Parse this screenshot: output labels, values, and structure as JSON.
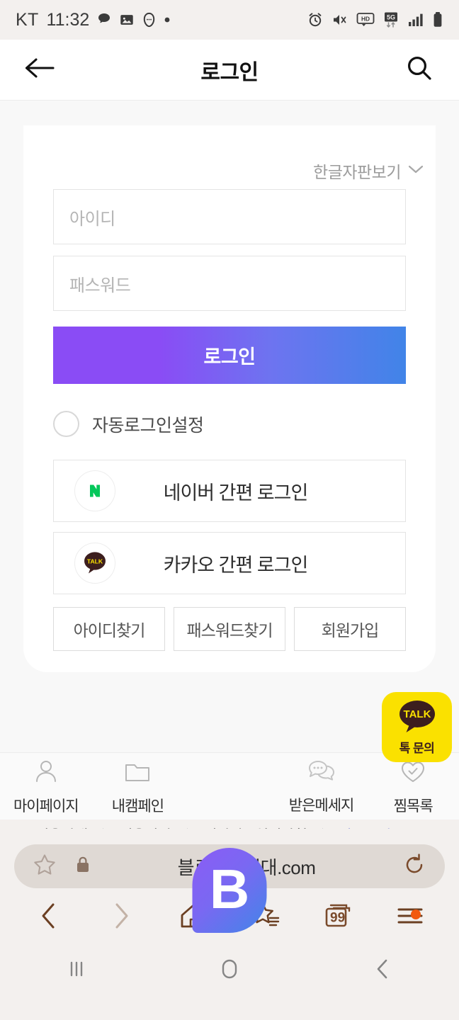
{
  "statusbar": {
    "carrier": "KT",
    "time": "11:32",
    "icons_left": [
      "chat-icon",
      "image-icon",
      "face-icon",
      "dot-icon"
    ],
    "icons_right": [
      "alarm-icon",
      "mute-icon",
      "hd-icon",
      "5g-icon",
      "signal-icon",
      "battery-icon"
    ]
  },
  "header": {
    "title": "로그인",
    "back_icon": "back-arrow-icon",
    "search_icon": "search-icon"
  },
  "login": {
    "keyboard_toggle": "한글자판보기",
    "id_placeholder": "아이디",
    "password_placeholder": "패스워드",
    "id_value": "",
    "password_value": "",
    "submit_label": "로그인",
    "auto_login_label": "자동로그인설정",
    "auto_login_checked": false,
    "social": [
      {
        "label": "네이버 간편 로그인",
        "icon": "naver-icon",
        "color": "#03c75a"
      },
      {
        "label": "카카오 간편 로그인",
        "icon": "kakao-talk-icon",
        "color": "#3c1e1e"
      }
    ],
    "links": [
      "아이디찾기",
      "패스워드찾기",
      "회원가입"
    ]
  },
  "kakao_float": {
    "label": "톡 문의",
    "badge": "TALK",
    "bg": "#fae100"
  },
  "footer": {
    "links": [
      "이용안내",
      "이용약관",
      "개인정보처리방침"
    ],
    "ad_link": "광고문의"
  },
  "bottomnav": {
    "items": [
      {
        "label": "마이페이지",
        "icon": "person-icon"
      },
      {
        "label": "내캠페인",
        "icon": "folder-icon"
      },
      {
        "label": "받은메세지",
        "icon": "chat-bubbles-icon"
      },
      {
        "label": "찜목록",
        "icon": "heart-check-icon"
      }
    ],
    "center_logo": "B"
  },
  "browser": {
    "url": "블로그원정대.com",
    "star_icon": "star-icon",
    "lock_icon": "lock-icon",
    "reload_icon": "reload-icon",
    "toolbar": [
      "back-icon",
      "forward-icon",
      "home-icon",
      "bookmarks-icon",
      "tabs-icon",
      "menu-icon"
    ],
    "tab_count": "99"
  },
  "androidnav": [
    "recents-icon",
    "home-icon",
    "back-icon"
  ],
  "theme": {
    "accent_start": "#8a4cf5",
    "accent_end": "#4184e8",
    "kakao_yellow": "#fae100",
    "naver_green": "#03c75a"
  }
}
